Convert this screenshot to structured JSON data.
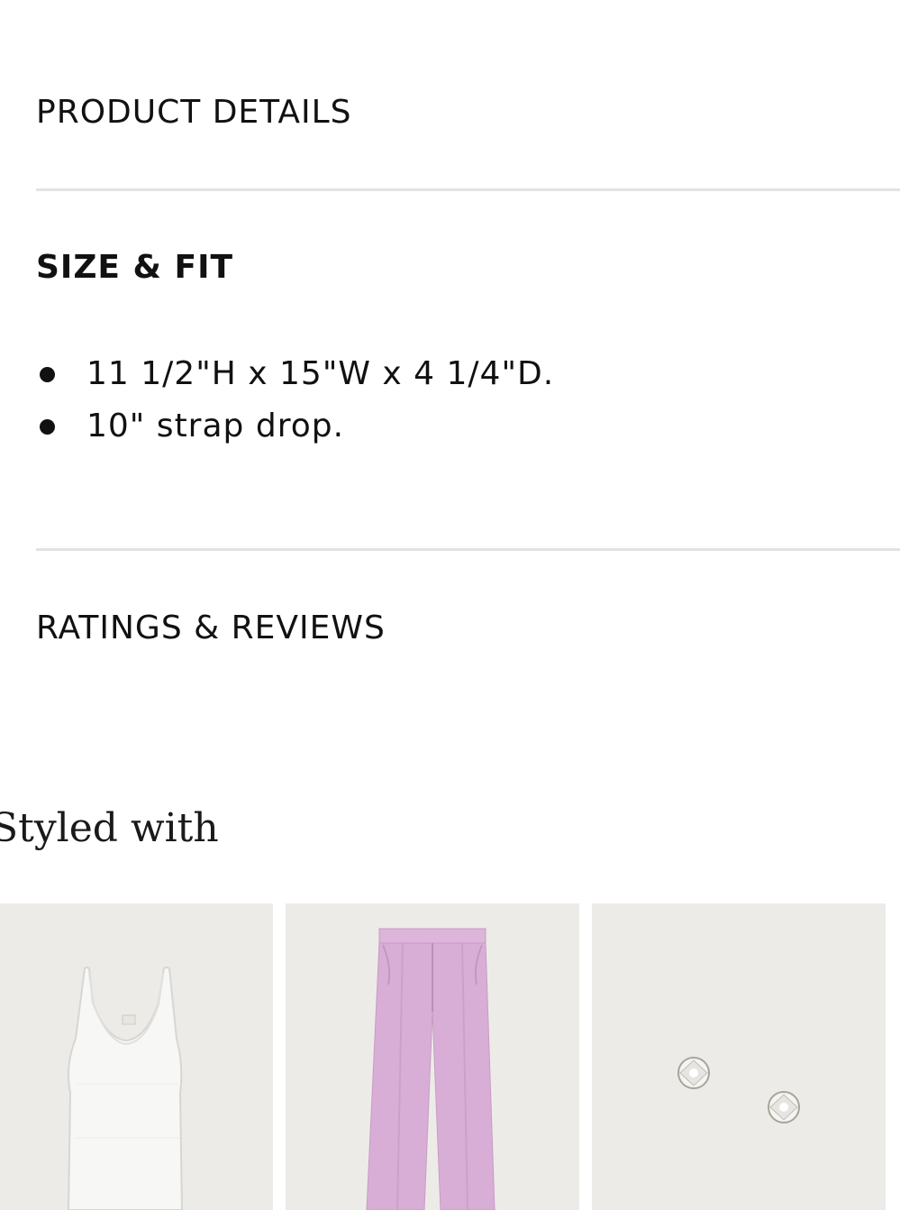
{
  "accordion": {
    "product_details_label": "PRODUCT DETAILS",
    "size_fit_label": "SIZE & FIT",
    "size_fit_bullets": [
      "11 1/2\"H x 15\"W x 4 1/4\"D.",
      "10\" strap drop."
    ],
    "ratings_reviews_label": "RATINGS & REVIEWS"
  },
  "styled_with": {
    "heading": "Styled with",
    "products": [
      {
        "image": "white-tank-top"
      },
      {
        "image": "pink-pleated-trousers"
      },
      {
        "image": "diamond-stud-earrings"
      },
      {
        "image": "partial-next-item"
      }
    ]
  },
  "colors": {
    "text": "#111111",
    "divider": "#e3e3e3",
    "tile_background": "#ecebe8",
    "trouser_pink": "#d9aed6"
  }
}
